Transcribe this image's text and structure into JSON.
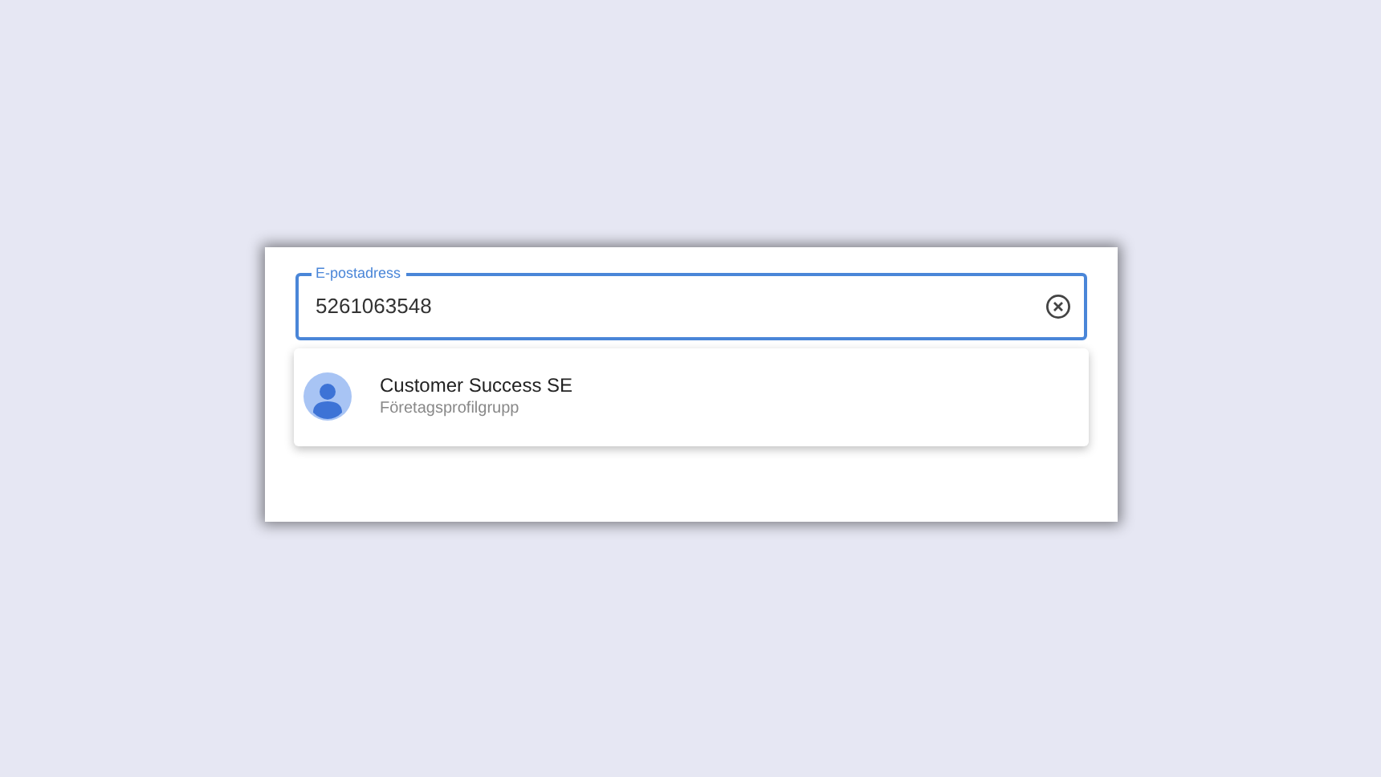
{
  "field": {
    "label": "E-postadress",
    "value": "5261063548"
  },
  "suggestions": [
    {
      "name": "Customer Success SE",
      "type": "Företagsprofilgrupp"
    }
  ]
}
